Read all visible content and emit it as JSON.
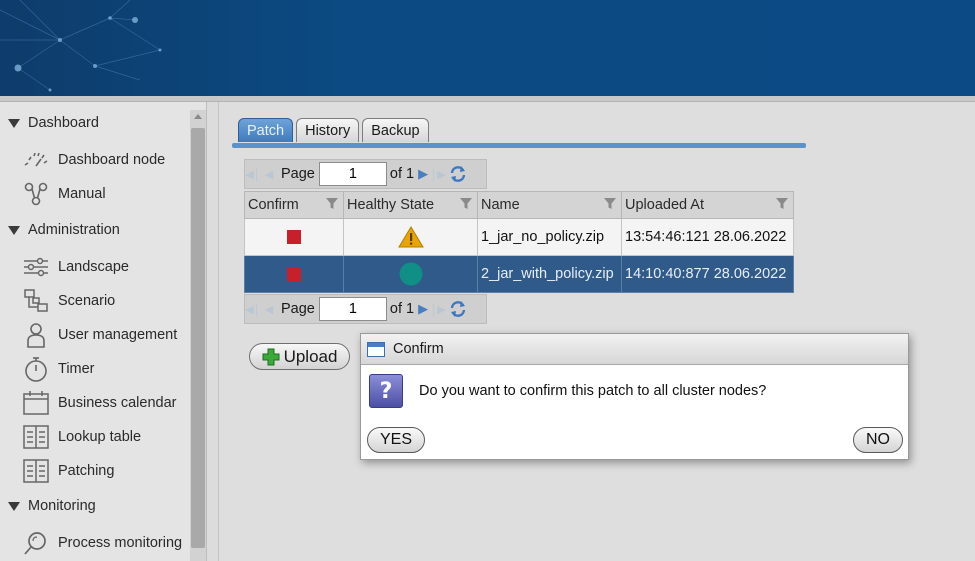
{
  "sidebar": {
    "sections": [
      {
        "label": "Dashboard",
        "items": [
          {
            "label": "Dashboard node",
            "icon": "gauge-icon"
          },
          {
            "label": "Manual",
            "icon": "share-nodes-icon"
          }
        ]
      },
      {
        "label": "Administration",
        "items": [
          {
            "label": "Landscape",
            "icon": "sliders-icon"
          },
          {
            "label": "Scenario",
            "icon": "flowchart-icon"
          },
          {
            "label": "User management",
            "icon": "user-icon"
          },
          {
            "label": "Timer",
            "icon": "stopwatch-icon"
          },
          {
            "label": "Business calendar",
            "icon": "calendar-icon"
          },
          {
            "label": "Lookup table",
            "icon": "table-icon"
          },
          {
            "label": "Patching",
            "icon": "patch-icon"
          }
        ]
      },
      {
        "label": "Monitoring",
        "items": [
          {
            "label": "Process monitoring",
            "icon": "magnifier-icon"
          }
        ]
      }
    ]
  },
  "tabs": [
    {
      "label": "Patch",
      "active": true
    },
    {
      "label": "History",
      "active": false
    },
    {
      "label": "Backup",
      "active": false
    }
  ],
  "pager": {
    "page_label": "Page",
    "page_value": "1",
    "of_label": "of 1"
  },
  "grid": {
    "columns": [
      "Confirm",
      "Healthy State",
      "Name",
      "Uploaded At"
    ],
    "rows": [
      {
        "confirm": "stop-icon",
        "state": "warning-icon",
        "name": "1_jar_no_policy.zip",
        "uploaded": "13:54:46:121 28.06.2022",
        "selected": false
      },
      {
        "confirm": "stop-icon",
        "state": "ok-icon",
        "name": "2_jar_with_policy.zip",
        "uploaded": "14:10:40:877 28.06.2022",
        "selected": true
      }
    ]
  },
  "upload_label": "Upload",
  "dialog": {
    "title": "Confirm",
    "message": "Do you want to confirm this patch to all cluster nodes?",
    "yes_label": "YES",
    "no_label": "NO"
  },
  "colors": {
    "header": "#0b4a82",
    "selected_row": "#2f5a8a",
    "active_tab": "#4a85c6",
    "stop": "#c8202a",
    "warning": "#e8a400",
    "ok": "#0f8f86"
  }
}
